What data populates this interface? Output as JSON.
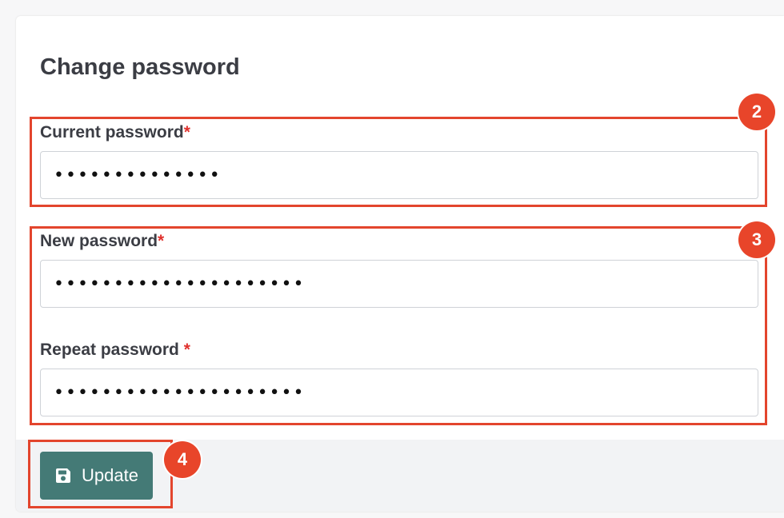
{
  "form": {
    "title": "Change password",
    "current_password": {
      "label": "Current password",
      "required_mark": "*",
      "value": "••••••••••••••"
    },
    "new_password": {
      "label": "New password",
      "required_mark": "*",
      "value": "•••••••••••••••••••••"
    },
    "repeat_password": {
      "label": "Repeat password",
      "required_mark": "*",
      "value": "•••••••••••••••••••••"
    },
    "update_button": {
      "label": "Update",
      "icon": "save-icon"
    }
  },
  "callouts": {
    "current": "2",
    "new_and_repeat": "3",
    "update": "4"
  },
  "colors": {
    "accent_button": "#447a76",
    "callout": "#e8452a",
    "required": "#e0322e"
  }
}
